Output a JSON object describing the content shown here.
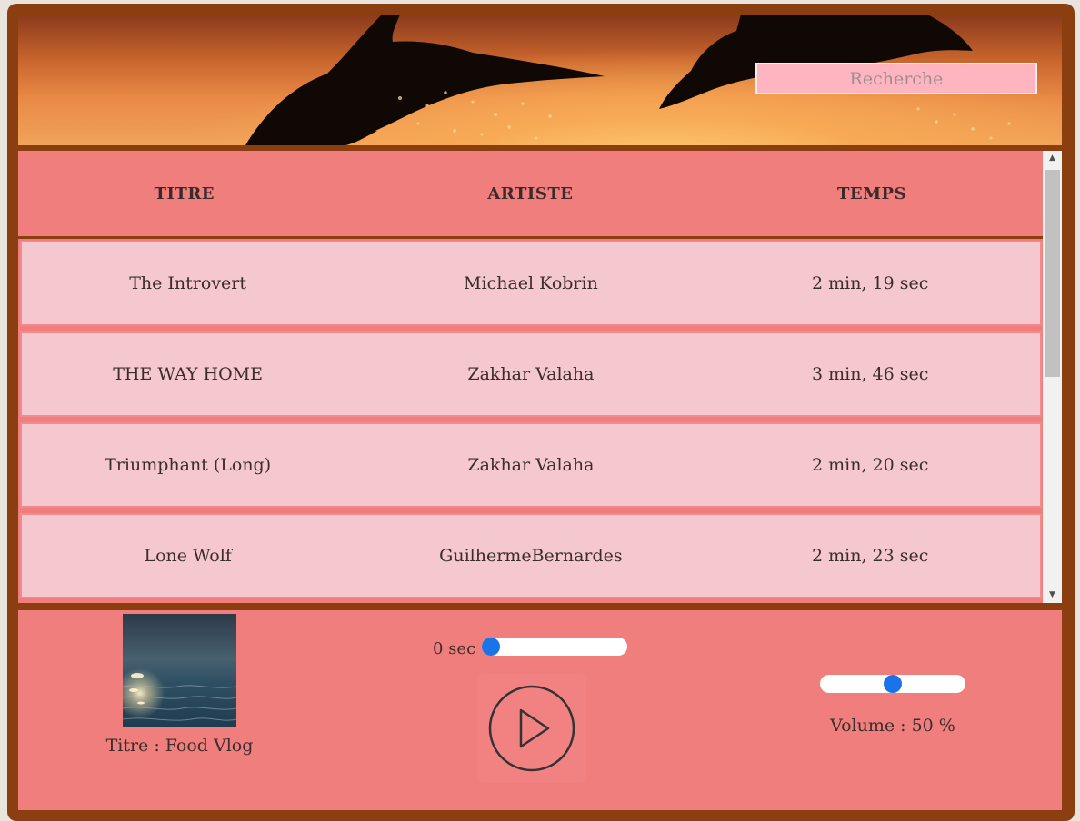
{
  "search": {
    "placeholder": "Recherche"
  },
  "table": {
    "headers": [
      "TITRE",
      "ARTISTE",
      "TEMPS"
    ],
    "rows": [
      {
        "title": "The Introvert",
        "artist": "Michael Kobrin",
        "time": "2 min, 19 sec"
      },
      {
        "title": "THE WAY HOME",
        "artist": "Zakhar Valaha",
        "time": "3 min, 46 sec"
      },
      {
        "title": "Triumphant (Long)",
        "artist": "Zakhar Valaha",
        "time": "2 min, 20 sec"
      },
      {
        "title": "Lone Wolf",
        "artist": "GuilhermeBernardes",
        "time": "2 min, 23 sec"
      }
    ]
  },
  "player": {
    "now_playing": "Titre : Food Vlog",
    "elapsed": "0 sec",
    "progress_fraction": 0,
    "volume_label": "Volume : 50 %",
    "volume_fraction": 0.5,
    "play_icon": "play-icon"
  },
  "colors": {
    "frame": "#8b3e0f",
    "panel": "#f07e7d",
    "row": "#f5c7ce",
    "search_bg": "#ffb5c0",
    "slider_knob": "#1a73e8"
  }
}
